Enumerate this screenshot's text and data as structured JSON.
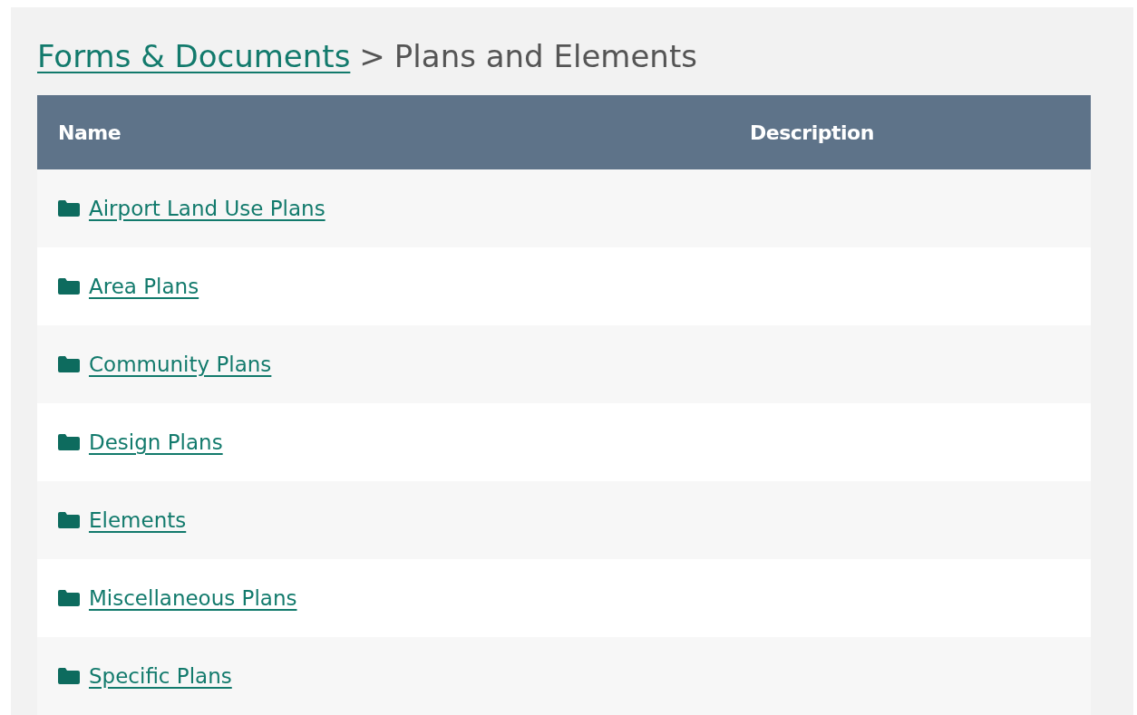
{
  "breadcrumb": {
    "link": "Forms & Documents",
    "separator": ">",
    "current": "Plans and Elements"
  },
  "table": {
    "columns": [
      "Name",
      "Description"
    ],
    "rows": [
      {
        "name": "Airport Land Use Plans"
      },
      {
        "name": "Area Plans"
      },
      {
        "name": "Community Plans"
      },
      {
        "name": "Design Plans"
      },
      {
        "name": "Elements"
      },
      {
        "name": "Miscellaneous Plans"
      },
      {
        "name": "Specific Plans"
      }
    ]
  }
}
